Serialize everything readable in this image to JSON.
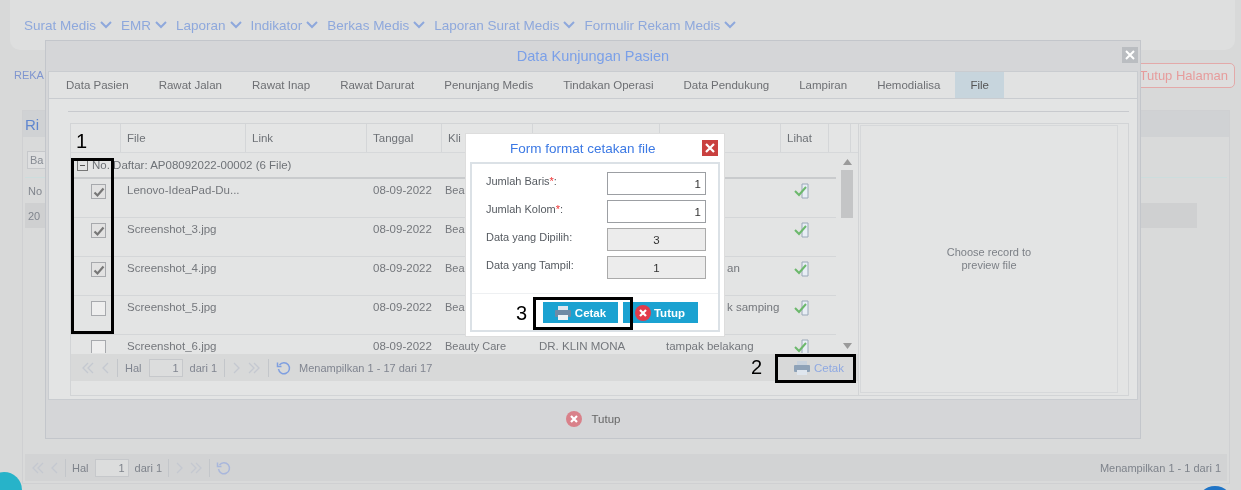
{
  "nav": [
    {
      "label": "Surat Medis"
    },
    {
      "label": "EMR"
    },
    {
      "label": "Laporan"
    },
    {
      "label": "Indikator"
    },
    {
      "label": "Berkas Medis"
    },
    {
      "label": "Laporan Surat Medis"
    },
    {
      "label": "Formulir Rekam Medis"
    }
  ],
  "page": {
    "breadcrumb": "REKA",
    "close_button": "Tutup Halaman",
    "panel_title": "Ri",
    "search_placeholder": "Ba",
    "grid_header": "No",
    "grid_row": "20",
    "pager": {
      "page_label": "Hal",
      "page": "1",
      "of": "dari 1",
      "summary": "Menampilkan 1 - 1 dari 1"
    }
  },
  "modal": {
    "title": "Data Kunjungan Pasien",
    "tabs": [
      {
        "label": "Data Pasien",
        "selected": false
      },
      {
        "label": "Rawat Jalan",
        "selected": false
      },
      {
        "label": "Rawat Inap",
        "selected": false
      },
      {
        "label": "Rawat Darurat",
        "selected": false
      },
      {
        "label": "Penunjang Medis",
        "selected": false
      },
      {
        "label": "Tindakan Operasi",
        "selected": false
      },
      {
        "label": "Data Pendukung",
        "selected": false
      },
      {
        "label": "Lampiran",
        "selected": false
      },
      {
        "label": "Hemodialisa",
        "selected": false
      },
      {
        "label": "File",
        "selected": true
      }
    ],
    "grid": {
      "columns": [
        "File",
        "Link",
        "Tanggal",
        "Kli",
        "Lihat"
      ],
      "group": "No. Daftar: AP08092022-00002 (6 File)",
      "rows": [
        {
          "checked": true,
          "file": "Lenovo-IdeaPad-Du...",
          "tanggal": "08-09-2022",
          "klinik": "Bea"
        },
        {
          "checked": true,
          "file": "Screenshot_3.jpg",
          "tanggal": "08-09-2022",
          "klinik": "Bea"
        },
        {
          "checked": true,
          "file": "Screenshot_4.jpg",
          "tanggal": "08-09-2022",
          "klinik": "Bea",
          "keterangan": "an"
        },
        {
          "checked": false,
          "file": "Screenshot_5.jpg",
          "tanggal": "08-09-2022",
          "klinik": "Bea",
          "keterangan": "k samping"
        },
        {
          "checked": false,
          "file": "Screenshot_6.jpg",
          "tanggal": "08-09-2022",
          "klinik": "Beauty Care",
          "dokter": "DR. KLIN MONA",
          "keterangan": "tampak belakang"
        }
      ],
      "pager": {
        "page_label": "Hal",
        "page": "1",
        "of": "dari 1",
        "summary": "Menampilkan 1 - 17 dari 17"
      },
      "print_button": "Cetak"
    },
    "preview_text": "Choose record to preview file",
    "close_button": "Tutup"
  },
  "dialog": {
    "title": "Form format cetakan file",
    "fields": [
      {
        "label": "Jumlah Baris",
        "required_mark": "*",
        "label_end": ":",
        "value": "1",
        "readonly": false
      },
      {
        "label": "Jumlah Kolom",
        "required_mark": "*",
        "label_end": ":",
        "value": "1",
        "readonly": false
      },
      {
        "label": "Data yang Dipilih:",
        "value": "3",
        "readonly": true
      },
      {
        "label": "Data yang Tampil:",
        "value": "1",
        "readonly": true
      }
    ],
    "buttons": [
      {
        "label": "Cetak",
        "kind": "print"
      },
      {
        "label": "Tutup",
        "kind": "close"
      }
    ]
  },
  "annotations": [
    {
      "number": "1",
      "kind": "checkboxes"
    },
    {
      "number": "2",
      "kind": "grid-print"
    },
    {
      "number": "3",
      "kind": "dialog-print"
    }
  ]
}
